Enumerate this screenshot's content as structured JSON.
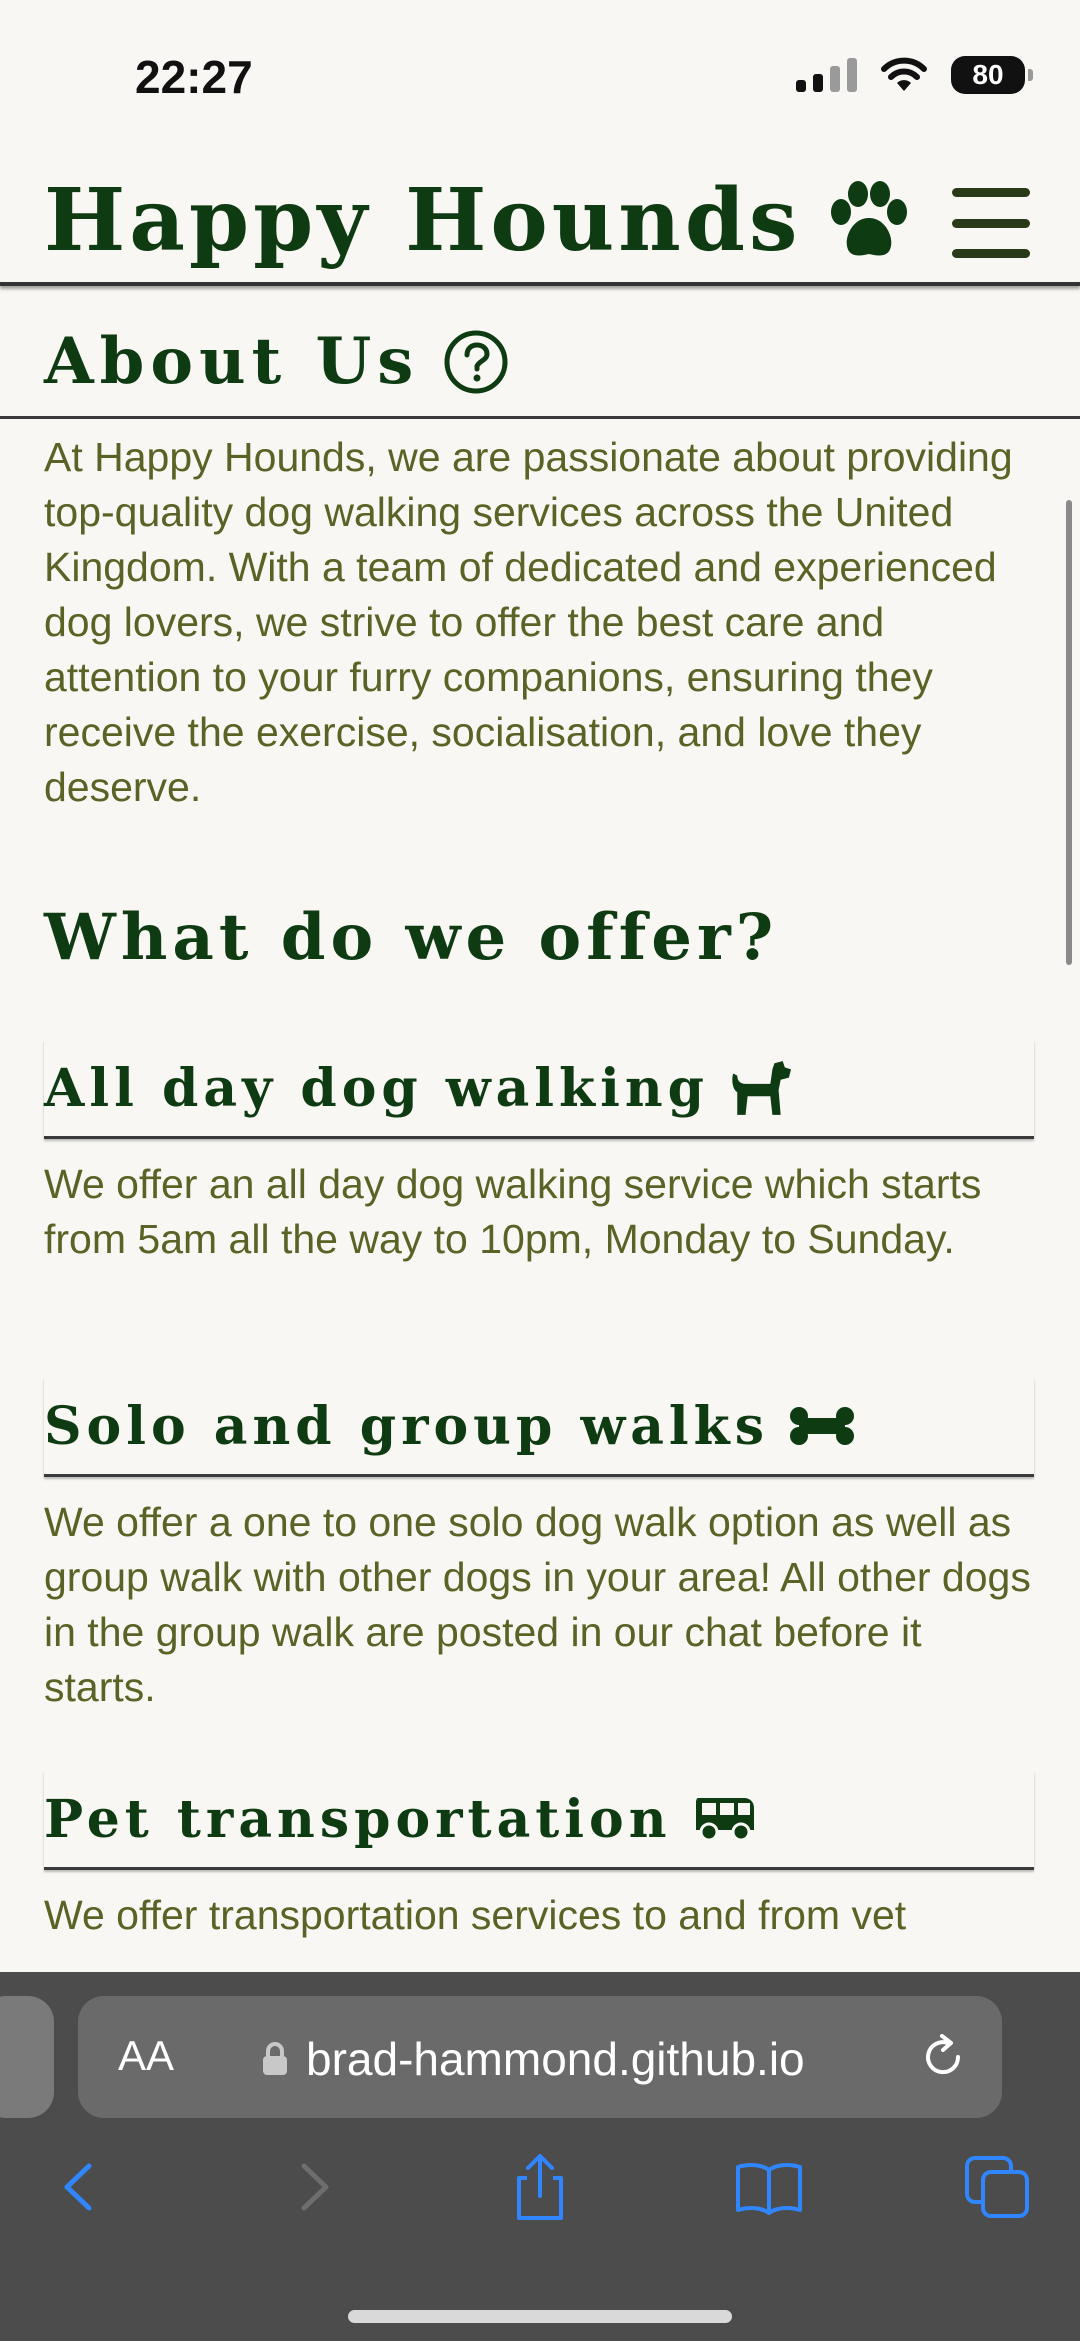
{
  "status_bar": {
    "time": "22:27",
    "battery": "80",
    "battery_percent": 80
  },
  "header": {
    "title": "Happy Hounds",
    "logo_icon": "paw-icon",
    "menu_icon": "hamburger-menu-icon"
  },
  "about": {
    "title": "About Us",
    "icon": "question-circle-icon",
    "text": "At Happy Hounds, we are passionate about providing top-quality dog walking services across the United Kingdom. With a team of dedicated and experienced dog lovers, we strive to offer the best care and attention to your furry companions, ensuring they receive the exercise, socialisation, and love they deserve."
  },
  "offer": {
    "title": "What do we offer?",
    "services": [
      {
        "title": "All day dog walking",
        "icon": "dog-icon",
        "text": "We offer an all day dog walking service which starts from 5am all the way to 10pm, Monday to Sunday."
      },
      {
        "title": "Solo and group walks",
        "icon": "bone-icon",
        "text": "We offer a one to one solo dog walk option as well as group walk with other dogs in your area! All other dogs in the group walk are posted in our chat before it starts."
      },
      {
        "title": "Pet transportation",
        "icon": "van-icon",
        "text": "We offer transportation services to and from vet"
      }
    ]
  },
  "browser": {
    "text_size_label": "AA",
    "url": "brad-hammond.github.io",
    "lock_icon": "lock-icon",
    "reload_icon": "reload-icon",
    "toolbar": {
      "back_icon": "chevron-left-icon",
      "forward_icon": "chevron-right-icon",
      "share_icon": "share-icon",
      "bookmarks_icon": "book-icon",
      "tabs_icon": "tabs-icon"
    }
  },
  "colors": {
    "brand_green": "#0f3b12",
    "text_olive": "#5a6325",
    "background": "#f8f7f3",
    "safari_blue": "#2f86ff"
  }
}
